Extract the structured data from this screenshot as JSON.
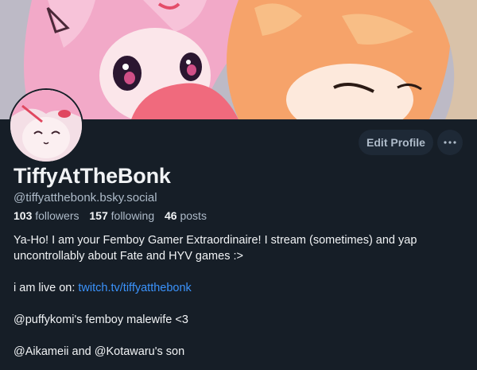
{
  "profile": {
    "display_name": "TiffyAtTheBonk",
    "handle": "@tiffyatthebonk.bsky.social",
    "followers_count": "103",
    "followers_label": "followers",
    "following_count": "157",
    "following_label": "following",
    "posts_count": "46",
    "posts_label": "posts"
  },
  "actions": {
    "edit_profile_label": "Edit Profile",
    "more_icon": "ellipsis-icon"
  },
  "bio": {
    "line1": "Ya-Ho! I am your Femboy Gamer Extraordinaire! I stream (sometimes) and yap uncontrollably about Fate and HYV games :>",
    "live_prefix": "i am live on: ",
    "live_link": "twitch.tv/tiffyatthebonk",
    "line3": "@puffykomi's femboy malewife <3",
    "line4": "@Aikameii and @Kotawaru's son"
  },
  "colors": {
    "background": "#161e27",
    "button_bg": "#1e2936",
    "muted_text": "#aebbc9",
    "link": "#3b93fc"
  }
}
